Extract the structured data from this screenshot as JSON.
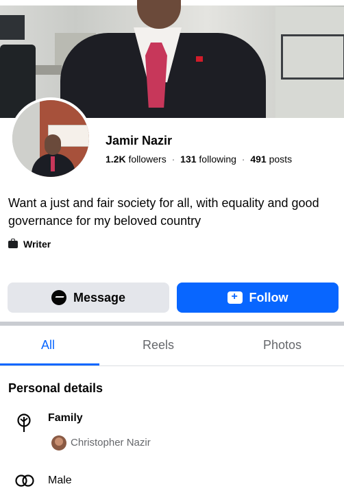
{
  "profile": {
    "name": "Jamir Nazir",
    "followers_count": "1.2K",
    "followers_label": "followers",
    "following_count": "131",
    "following_label": "following",
    "posts_count": "491",
    "posts_label": "posts",
    "separator": "·",
    "bio": "Want a just and fair society for all, with equality and good governance for my beloved country",
    "job": "Writer"
  },
  "actions": {
    "message_label": "Message",
    "follow_label": "Follow"
  },
  "tabs": [
    {
      "label": "All",
      "active": true
    },
    {
      "label": "Reels",
      "active": false
    },
    {
      "label": "Photos",
      "active": false
    }
  ],
  "details": {
    "title": "Personal details",
    "family_label": "Family",
    "family_member": "Christopher Nazir",
    "gender": "Male"
  },
  "colors": {
    "accent": "#0866ff",
    "secondary_button": "#e4e6eb",
    "muted_text": "#65676b"
  },
  "icons": [
    "messenger-icon",
    "add-friend-icon",
    "briefcase-icon",
    "family-tree-icon",
    "gender-icon"
  ]
}
